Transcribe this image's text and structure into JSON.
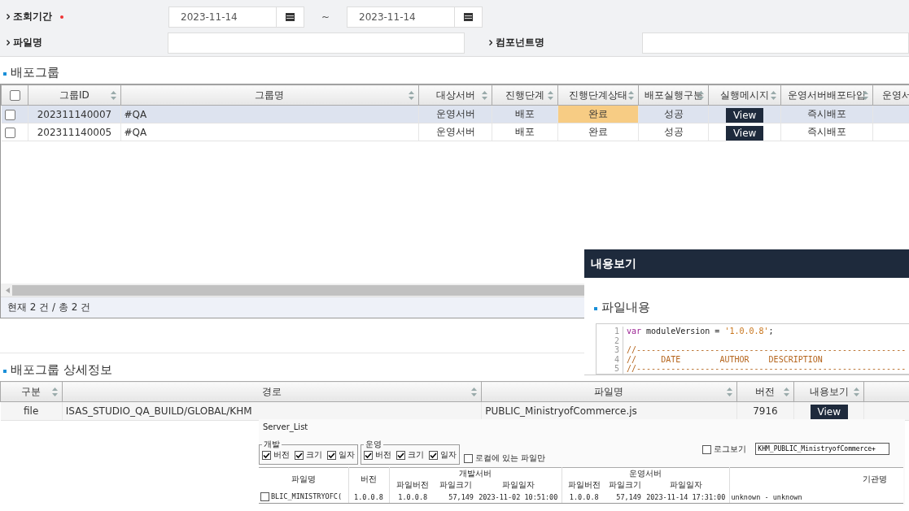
{
  "filters": {
    "period": {
      "label": "조회기간",
      "required": true,
      "from": "2023-11-14",
      "separator": "~",
      "to": "2023-11-14"
    },
    "file_name": {
      "label": "파일명"
    },
    "component_name": {
      "label": "컴포넌트명"
    }
  },
  "group_section": {
    "title": "배포그룹",
    "header_checked": false,
    "columns": [
      {
        "label": "그룹ID",
        "sortable": true
      },
      {
        "label": "그룹명",
        "sortable": true
      },
      {
        "label": "대상서버",
        "sortable": true
      },
      {
        "label": "진행단계",
        "sortable": true
      },
      {
        "label": "진행단계상태",
        "sortable": true
      },
      {
        "label": "배포실행구분",
        "sortable": true
      },
      {
        "label": "실행메시지",
        "sortable": true
      },
      {
        "label": "운영서버배포타입",
        "sortable": true
      },
      {
        "label": "운영서"
      }
    ],
    "rows": [
      {
        "selected": true,
        "checked": false,
        "group_id": "202311140007",
        "group_name": "#QA",
        "target_server": "운영서버",
        "stage": "배포",
        "stage_status": "완료",
        "status_highlighted": true,
        "exec_type": "성공",
        "message_button": "View",
        "deploy_type": "즉시배포"
      },
      {
        "selected": false,
        "checked": false,
        "group_id": "202311140005",
        "group_name": "#QA",
        "target_server": "운영서버",
        "stage": "배포",
        "stage_status": "완료",
        "status_highlighted": false,
        "exec_type": "성공",
        "message_button": "View",
        "deploy_type": "즉시배포"
      }
    ],
    "footer": "현재 2 건 / 총 2 건"
  },
  "detail_section": {
    "title": "배포그룹 상세정보",
    "columns": [
      {
        "label": "구분",
        "sortable": true
      },
      {
        "label": "경로",
        "sortable": true
      },
      {
        "label": "파일명",
        "sortable": true
      },
      {
        "label": "버전",
        "sortable": true
      },
      {
        "label": "내용보기",
        "sortable": true
      }
    ],
    "rows": [
      {
        "type": "file",
        "path": "ISAS_STUDIO_QA_BUILD/GLOBAL/KHM",
        "file_name": "PUBLIC_MinistryofCommerce.js",
        "version": "7916",
        "view_button": "View"
      }
    ]
  },
  "content_popup": {
    "title": "내용보기",
    "section_title": "파일내용",
    "code_lines": [
      {
        "number": "1",
        "tokens": [
          {
            "kind": "keyword",
            "text": "var"
          },
          {
            "kind": "plain",
            "text": " moduleVersion = "
          },
          {
            "kind": "string",
            "text": "'1.0.0.8'"
          },
          {
            "kind": "plain",
            "text": ";"
          }
        ]
      },
      {
        "number": "2"
      },
      {
        "number": "3",
        "tokens": [
          {
            "kind": "comment",
            "text": "//-------------------------------------------------------"
          }
        ]
      },
      {
        "number": "4",
        "tokens": [
          {
            "kind": "comment",
            "text": "//     DATE        AUTHOR    DESCRIPTION"
          }
        ]
      },
      {
        "number": "5",
        "tokens": [
          {
            "kind": "comment",
            "text": "//-------------------------------------------------------"
          }
        ]
      }
    ]
  },
  "server_list": {
    "title": "Server_List",
    "groups": [
      {
        "legend": "개발",
        "options": [
          {
            "label": "버전",
            "checked": true
          },
          {
            "label": "크기",
            "checked": true
          },
          {
            "label": "일자",
            "checked": true
          }
        ]
      },
      {
        "legend": "운영",
        "options": [
          {
            "label": "버전",
            "checked": true
          },
          {
            "label": "크기",
            "checked": true
          },
          {
            "label": "일자",
            "checked": true
          }
        ]
      }
    ],
    "local_only": {
      "label": "로컬에 있는 파일만",
      "checked": false
    },
    "log_view": {
      "label": "로그보기",
      "checked": false
    },
    "log_field": {
      "value": "KHM_PUBLIC_MinistryofCommerce+"
    },
    "header_groups": {
      "dev": "개발서버",
      "ops": "운영서버"
    },
    "columns": {
      "file_name": "파일명",
      "version": "버전",
      "dev_file_version": "파일버전",
      "dev_file_size": "파일크기",
      "dev_file_date": "파일일자",
      "ops_file_version": "파일버전",
      "ops_file_size": "파일크기",
      "ops_file_date": "파일일자",
      "agency": "기관명"
    },
    "rows": [
      {
        "checked": false,
        "file_name": "BLIC_MINISTRYOFC(",
        "version": "1.0.0.8",
        "dev_file_version": "1.0.0.8",
        "dev_file_size": "57,149",
        "dev_file_date": "2023-11-02 10:51:00",
        "ops_file_version": "1.0.0.8",
        "ops_file_size": "57,149",
        "ops_file_date": "2023-11-14 17:31:00",
        "agency": "unknown - unknown"
      }
    ]
  }
}
